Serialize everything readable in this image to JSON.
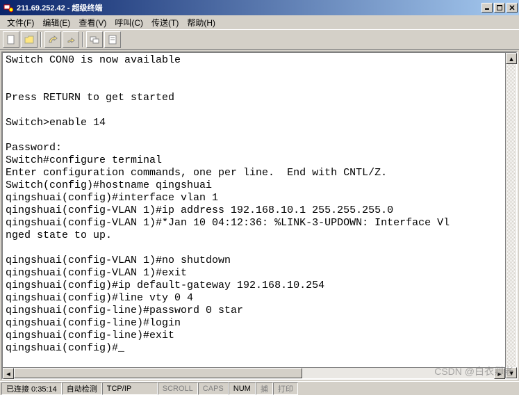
{
  "window": {
    "title": "211.69.252.42 - 超级终端",
    "min_label": "_",
    "max_label": "□",
    "close_label": "×"
  },
  "menubar": {
    "file": "文件(F)",
    "edit": "编辑(E)",
    "view": "查看(V)",
    "call": "呼叫(C)",
    "transfer": "传送(T)",
    "help": "帮助(H)"
  },
  "toolbar": {
    "icons": [
      "new-icon",
      "open-icon",
      "connect-icon",
      "disconnect-icon",
      "send-icon",
      "properties-icon"
    ]
  },
  "terminal": {
    "lines": [
      "Switch CON0 is now available",
      "",
      "",
      "Press RETURN to get started",
      "",
      "Switch>enable 14",
      "",
      "Password:",
      "Switch#configure terminal",
      "Enter configuration commands, one per line.  End with CNTL/Z.",
      "Switch(config)#hostname qingshuai",
      "qingshuai(config)#interface vlan 1",
      "qingshuai(config-VLAN 1)#ip address 192.168.10.1 255.255.255.0",
      "qingshuai(config-VLAN 1)#*Jan 10 04:12:36: %LINK-3-UPDOWN: Interface Vl",
      "nged state to up.",
      "",
      "qingshuai(config-VLAN 1)#no shutdown",
      "qingshuai(config-VLAN 1)#exit",
      "qingshuai(config)#ip default-gateway 192.168.10.254",
      "qingshuai(config)#line vty 0 4",
      "qingshuai(config-line)#password 0 star",
      "qingshuai(config-line)#login",
      "qingshuai(config-line)#exit",
      "qingshuai(config)#_"
    ]
  },
  "statusbar": {
    "connected": "已连接 0:35:14",
    "auto_detect": "自动检测",
    "protocol": "TCP/IP",
    "scroll": "SCROLL",
    "caps": "CAPS",
    "num": "NUM",
    "capture": "捕",
    "print": "打印"
  },
  "watermark": "CSDN @白衣卿老"
}
